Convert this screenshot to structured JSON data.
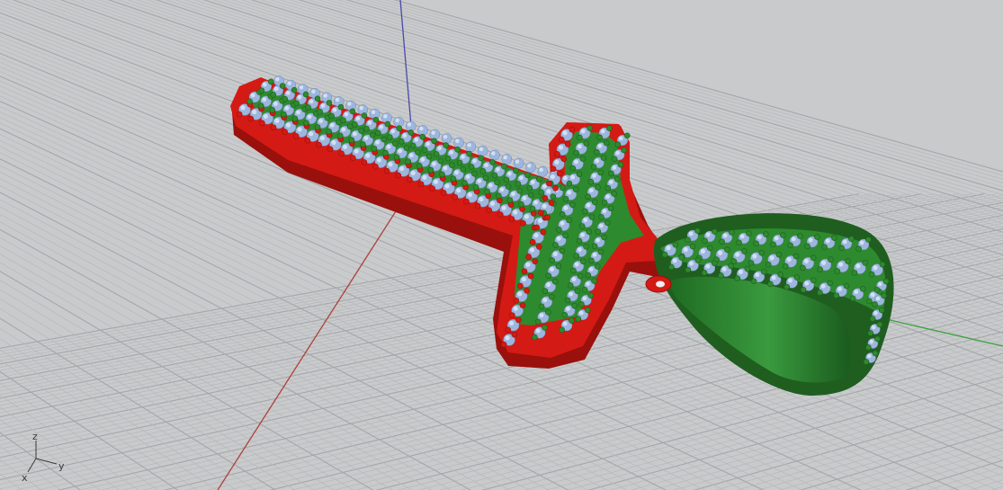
{
  "viewport": {
    "type": "perspective",
    "background": "#c8cacc",
    "grid_minor_color": "#b6b8ba",
    "grid_major_color": "#a4a6a9"
  },
  "world_axes": {
    "x_color": "#b0403a",
    "y_color": "#3aa23a",
    "z_color": "#4a4aa8"
  },
  "gizmo": {
    "z_label": "z",
    "y_label": "y",
    "x_label": "x"
  },
  "model": {
    "parts": [
      "cross-pendant",
      "bail"
    ],
    "colors": {
      "frame_red": "#d41a14",
      "frame_red_dark": "#9a100c",
      "prong_green": "#2e8a2e",
      "prong_green_dark": "#1f5e1f",
      "stone_blue": "#9cb6de",
      "stone_blue_light": "#d2e0f4"
    }
  }
}
